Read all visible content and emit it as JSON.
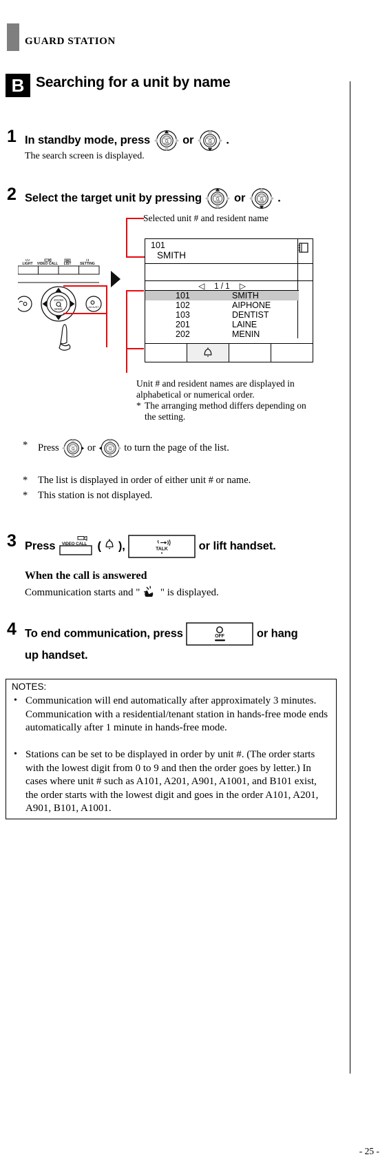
{
  "header": {
    "title": "GUARD STATION",
    "section_letter": "B",
    "section_title": "Searching for a unit by name"
  },
  "steps": [
    {
      "num": "1",
      "text_before": "In standby mode, press",
      "icon_a": "jog-dial-up-icon",
      "or": "or",
      "icon_b": "jog-dial-down-icon",
      "text_after": ".",
      "sub": "The search screen is displayed."
    },
    {
      "num": "2",
      "text_before": "Select the target unit by pressing",
      "icon_a": "jog-dial-up-icon",
      "or": "or",
      "icon_b": "jog-dial-down-icon",
      "text_after": "."
    },
    {
      "num": "3",
      "text_before": "Press",
      "key_label": "VIDEO CALL",
      "paren_open": "(",
      "paren_icon": "bell-icon",
      "paren_close": "),",
      "talk_key_label": "TALK",
      "text_after": "or lift handset."
    },
    {
      "num": "4",
      "text_before": "To end communication, press",
      "off_key_label": "OFF",
      "text_after": "or hang",
      "text_line2": "up handset."
    }
  ],
  "callouts": {
    "selected_unit": "Selected unit # and resident name",
    "list_note_line1": "Unit # and resident names are displayed in",
    "list_note_line2": "alphabetical or numerical order.",
    "list_note_star": "*",
    "list_note_line3": "The arranging method differs depending on",
    "list_note_line4": "the setting."
  },
  "device": {
    "button_labels": [
      "LIGHT",
      "VIDEO CALL",
      "LIST",
      "SETTING"
    ],
    "jog_center_label_top": "ZOOM",
    "jog_center_label_bottom": "WIDE",
    "left_key": "handset-icon",
    "right_key": "adjust-icon",
    "arrow": "flow-arrow-icon"
  },
  "lcd": {
    "selected_unit_number": "101",
    "selected_unit_name": "SMITH",
    "book_icon": "address-book-icon",
    "page_prev": "◁",
    "page_indicator": "1 / 1",
    "page_next": "▷",
    "rows": [
      {
        "number": "101",
        "name": "SMITH",
        "selected": true
      },
      {
        "number": "102",
        "name": "AIPHONE",
        "selected": false
      },
      {
        "number": "103",
        "name": "DENTIST",
        "selected": false
      },
      {
        "number": "201",
        "name": "LAINE",
        "selected": false
      },
      {
        "number": "202",
        "name": "MENIN",
        "selected": false
      }
    ],
    "softkeys": [
      "",
      "bell-icon",
      "",
      ""
    ]
  },
  "asterisk_notes": [
    {
      "star": "*",
      "pre": "Press",
      "icon_a": "jog-dial-right-icon",
      "mid": "or",
      "icon_b": "jog-dial-left-icon",
      "post": "to turn the page of the list."
    },
    {
      "star": "*",
      "text": "The list is displayed in order of either unit # or name."
    },
    {
      "star": "*",
      "text": "This station is not displayed."
    }
  ],
  "answered": {
    "heading": "When the call is answered",
    "pre": "Communication starts and \"",
    "icon": "talking-head-icon",
    "post": "\" is displayed."
  },
  "notes": {
    "title": "NOTES:",
    "items": [
      "Communication will end automatically after approximately 3 minutes. Communication with a residential/tenant station in hands-free mode ends automatically after 1 minute in hands-free mode.",
      "Stations can be set to be displayed in order by unit #. (The order starts with the lowest digit from 0 to 9 and then the order goes by letter.) In cases where unit # such as A101, A201, A901, A1001, and B101 exist, the order starts with the lowest digit and goes in the order A101, A201, A901, B101, A1001."
    ]
  },
  "footer": {
    "page": "- 25 -"
  },
  "colors": {
    "callout_red": "#e8090d",
    "header_gray": "#7f7f7f",
    "selection_gray": "#c8c8c8"
  }
}
